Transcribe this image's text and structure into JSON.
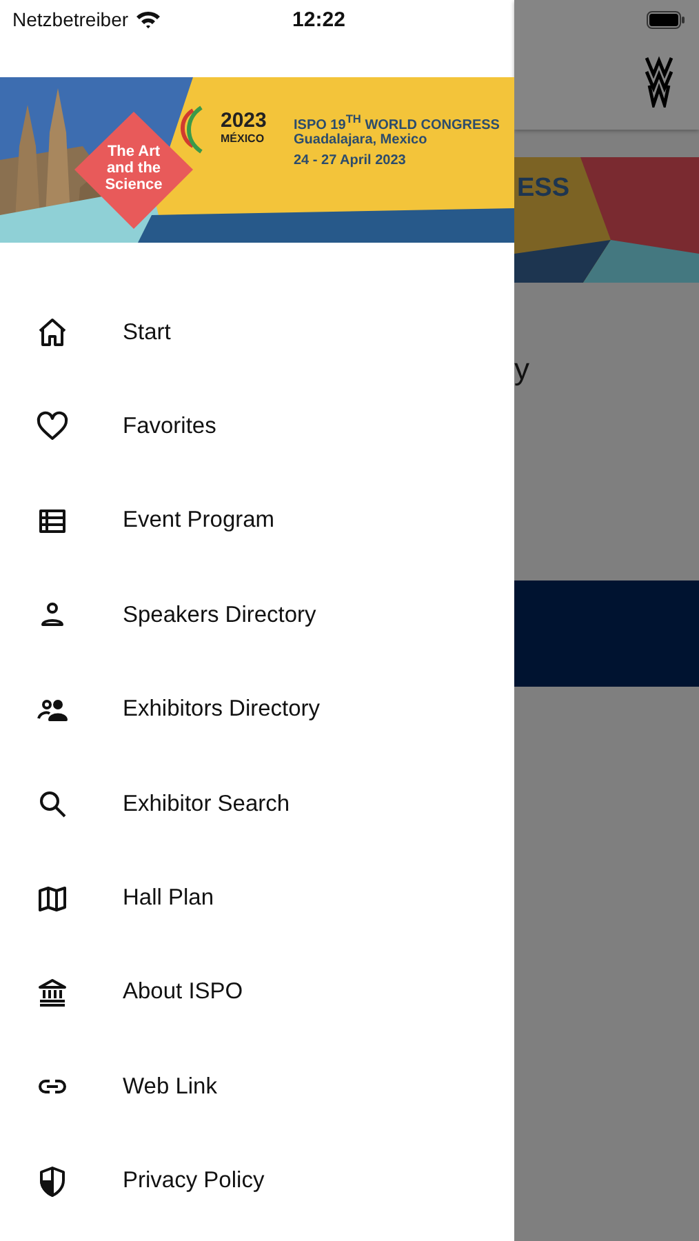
{
  "status_bar": {
    "carrier": "Netzbetreiber",
    "time": "12:22"
  },
  "banner": {
    "tagline": "The Art and the Science",
    "logo_year": "2023",
    "logo_country": "MÉXICO",
    "title": "ISPO 19$^{TH}$ WORLD CONGRESS",
    "location": "Guadalajara, Mexico",
    "dates": "24 - 27 April 2023"
  },
  "menu": [
    {
      "label": "Start"
    },
    {
      "label": "Favorites"
    },
    {
      "label": "Event Program"
    },
    {
      "label": "Speakers Directory"
    },
    {
      "label": "Exhibitors Directory"
    },
    {
      "label": "Exhibitor Search"
    },
    {
      "label": "Hall Plan"
    },
    {
      "label": "About ISPO"
    },
    {
      "label": "Web Link"
    },
    {
      "label": "Privacy Policy"
    }
  ],
  "background_page": {
    "banner_fragment": "ESS",
    "text_fragment": "y"
  }
}
